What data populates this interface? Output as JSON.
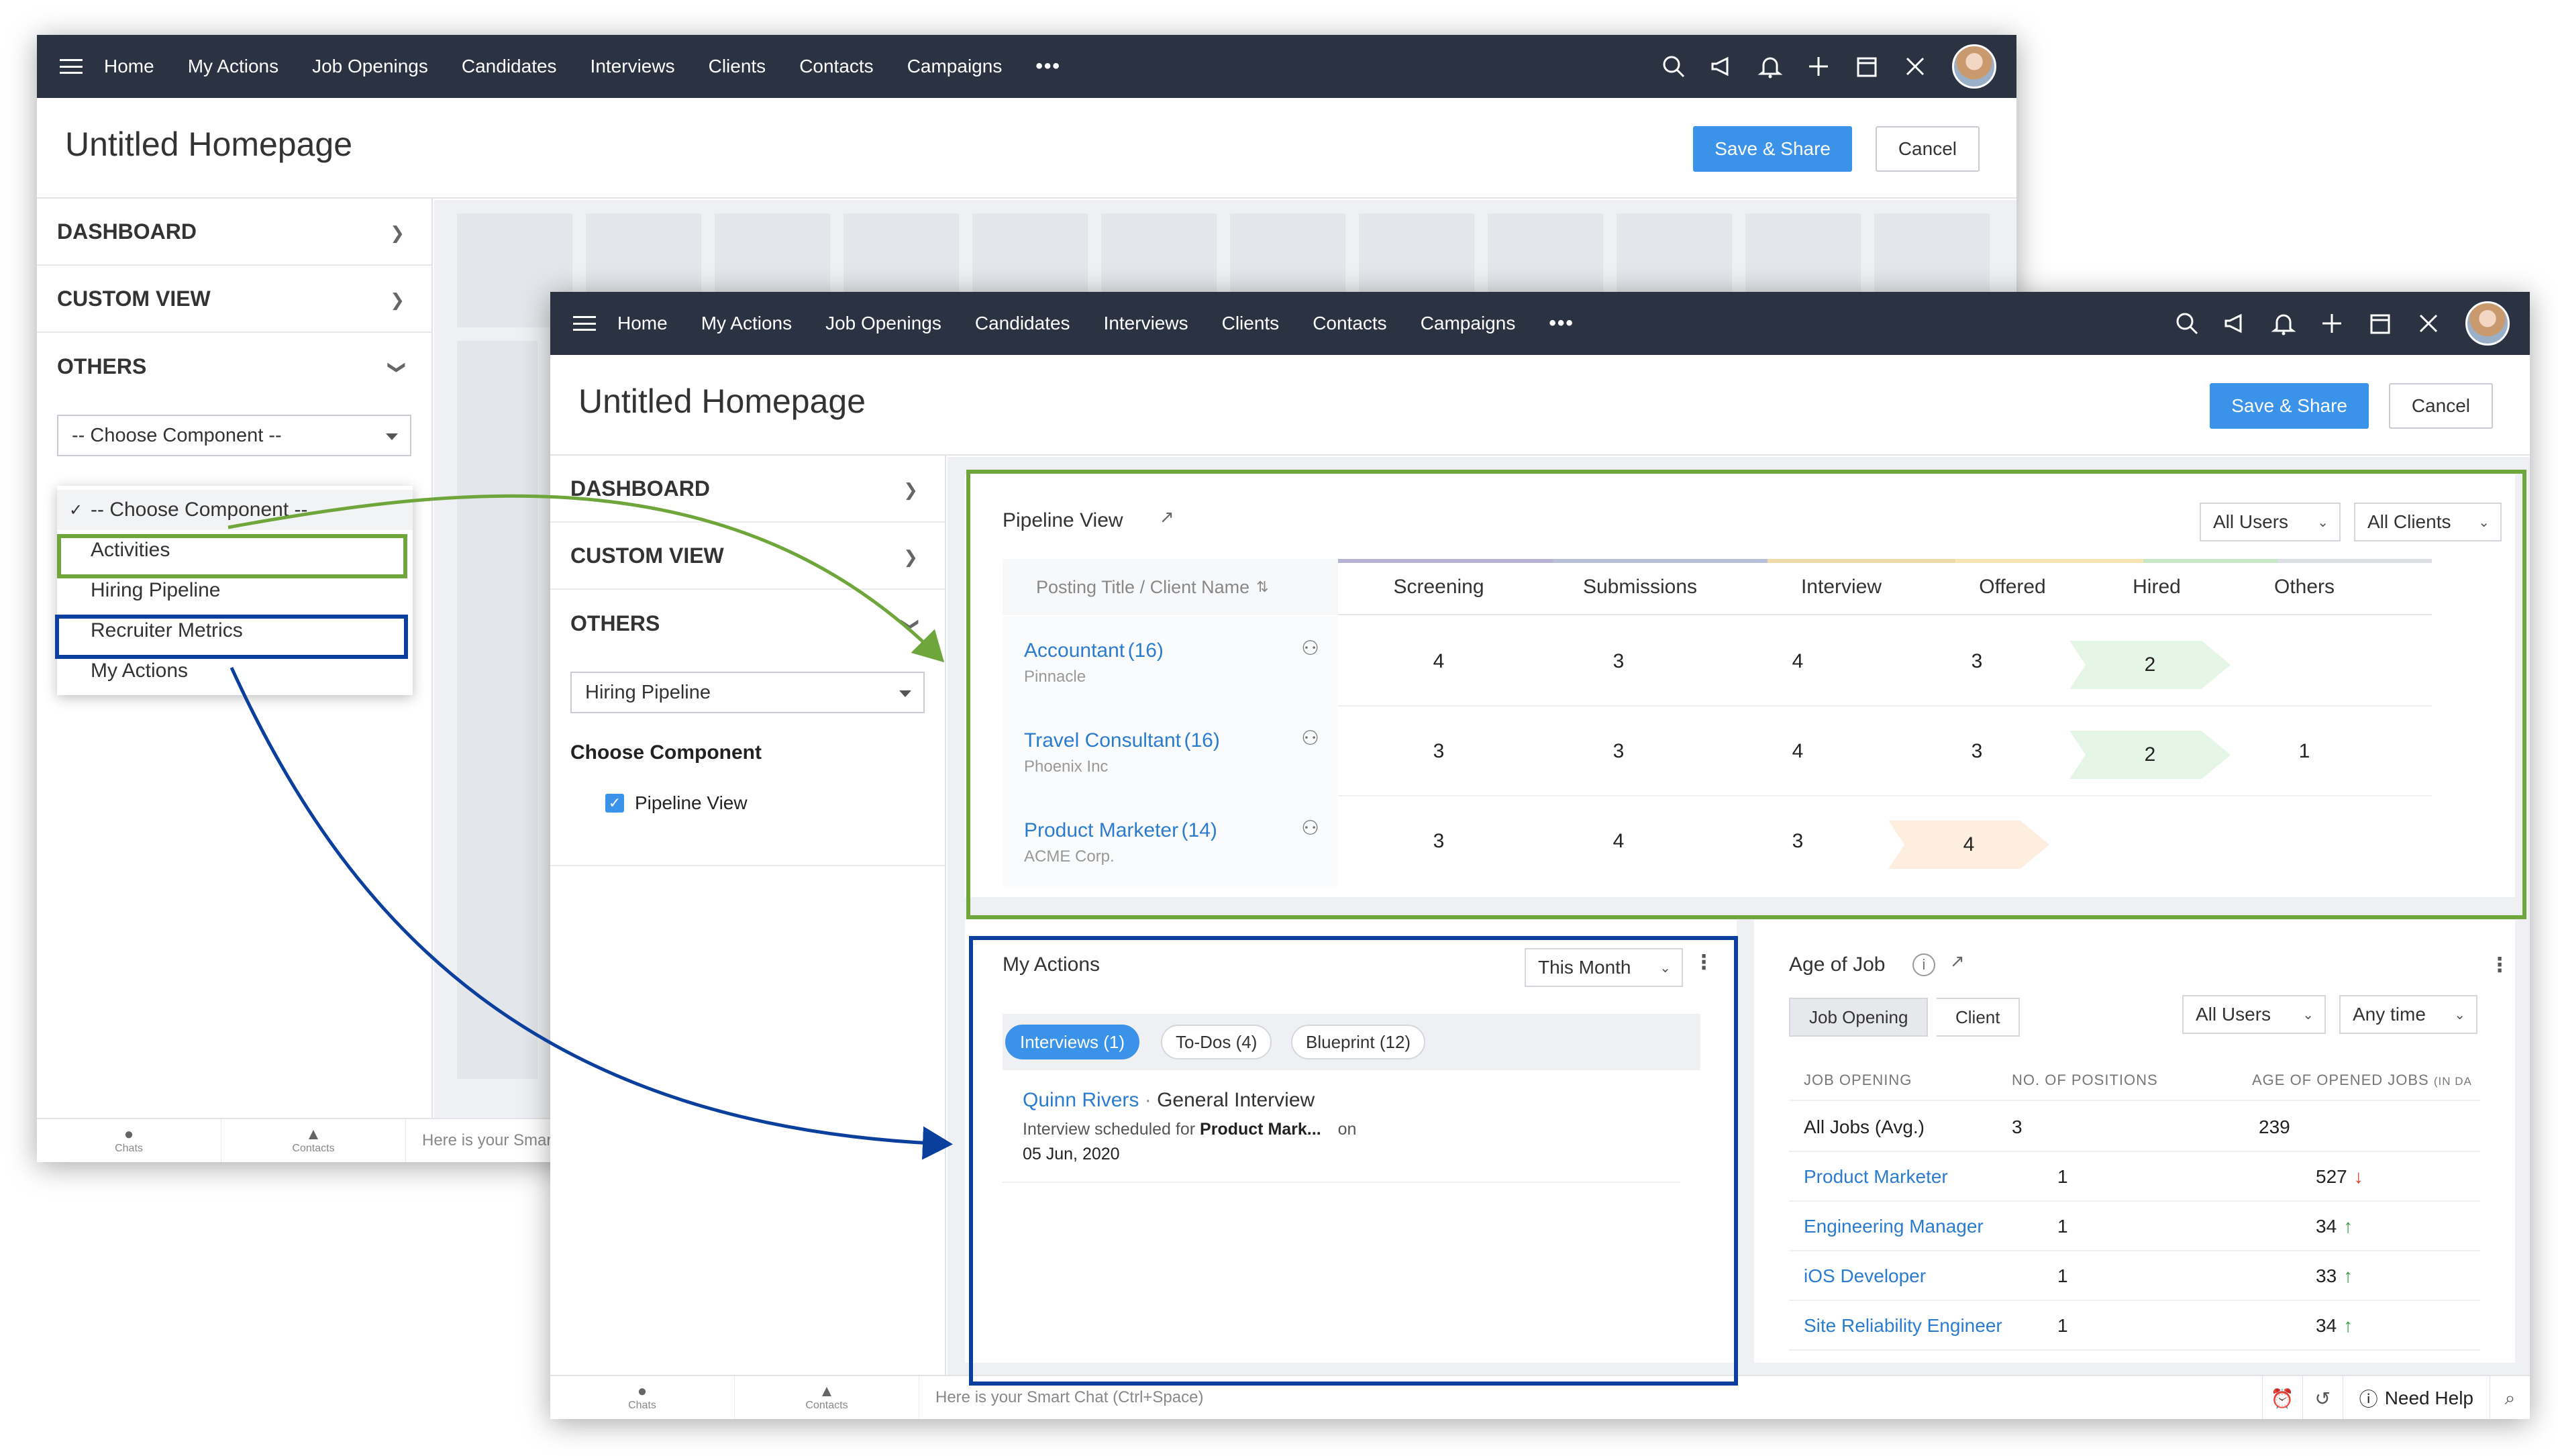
{
  "nav": {
    "items": [
      "Home",
      "My Actions",
      "Job Openings",
      "Candidates",
      "Interviews",
      "Clients",
      "Contacts",
      "Campaigns"
    ],
    "more": "•••"
  },
  "header": {
    "title": "Untitled Homepage",
    "save_share": "Save & Share",
    "cancel": "Cancel"
  },
  "sidebar": {
    "dashboard": "DASHBOARD",
    "custom_view": "CUSTOM VIEW",
    "others": "OTHERS",
    "choose_placeholder": "-- Choose Component --",
    "dropdown_options": [
      "-- Choose Component --",
      "Activities",
      "Hiring Pipeline",
      "Recruiter Metrics",
      "My Actions"
    ],
    "selected_value": "Hiring Pipeline",
    "choose_component_label": "Choose Component",
    "pipeline_checkbox_label": "Pipeline View"
  },
  "bottom": {
    "chats": "Chats",
    "contacts": "Contacts",
    "smart_chat_back": "Here is your Smar",
    "smart_chat": "Here is your Smart Chat (Ctrl+Space)",
    "need_help": "Need Help"
  },
  "pipeline": {
    "title": "Pipeline View",
    "users_filter": "All Users",
    "clients_filter": "All Clients",
    "first_col": "Posting Title / Client Name",
    "columns": [
      "Screening",
      "Submissions",
      "Interview",
      "Offered",
      "Hired",
      "Others"
    ],
    "stage_colors": [
      "#b7b3d6",
      "#b8bfd8",
      "#f0d9a6",
      "#f7e4b3",
      "#c7e6c6",
      "#dcdfe4"
    ],
    "rows": [
      {
        "title": "Accountant",
        "count": "(16)",
        "client": "Pinnacle",
        "values": [
          "4",
          "3",
          "4",
          "3",
          "2",
          ""
        ]
      },
      {
        "title": "Travel Consultant",
        "count": "(16)",
        "client": "Phoenix Inc",
        "values": [
          "3",
          "3",
          "4",
          "3",
          "2",
          "1"
        ]
      },
      {
        "title": "Product Marketer",
        "count": "(14)",
        "client": "ACME Corp.",
        "values": [
          "3",
          "4",
          "3",
          "4",
          "",
          ""
        ]
      }
    ],
    "highlight_green": "#e5f5e6",
    "highlight_orange": "#fdeee0"
  },
  "my_actions": {
    "title": "My Actions",
    "period": "This Month",
    "tabs": [
      "Interviews (1)",
      "To-Dos (4)",
      "Blueprint (12)"
    ],
    "item_name": "Quinn Rivers",
    "item_type": "General Interview",
    "item_desc_prefix": "Interview scheduled for",
    "item_desc_job": "Product Mark...",
    "item_desc_on": "on",
    "item_date": "05 Jun, 2020"
  },
  "age_of_job": {
    "title": "Age of Job",
    "segments": [
      "Job Opening",
      "Client"
    ],
    "users_filter": "All Users",
    "time_filter": "Any time",
    "headers": [
      "JOB OPENING",
      "NO. OF POSITIONS",
      "AGE OF OPENED JOBS"
    ],
    "header_suffix": "(IN DA",
    "rows": [
      {
        "name": "All Jobs (Avg.)",
        "positions": "3",
        "age": "239",
        "trend": "",
        "link": false
      },
      {
        "name": "Product Marketer",
        "positions": "1",
        "age": "527",
        "trend": "down",
        "link": true
      },
      {
        "name": "Engineering Manager",
        "positions": "1",
        "age": "34",
        "trend": "up",
        "link": true
      },
      {
        "name": "iOS Developer",
        "positions": "1",
        "age": "33",
        "trend": "up",
        "link": true
      },
      {
        "name": "Site Reliability Engineer",
        "positions": "1",
        "age": "34",
        "trend": "up",
        "link": true
      }
    ]
  },
  "colors": {
    "nav_bg": "#2b3342",
    "primary": "#3a93e8",
    "link": "#2b7ccf",
    "green_highlight": "#6fa63b",
    "blue_highlight": "#0b3f9e"
  }
}
